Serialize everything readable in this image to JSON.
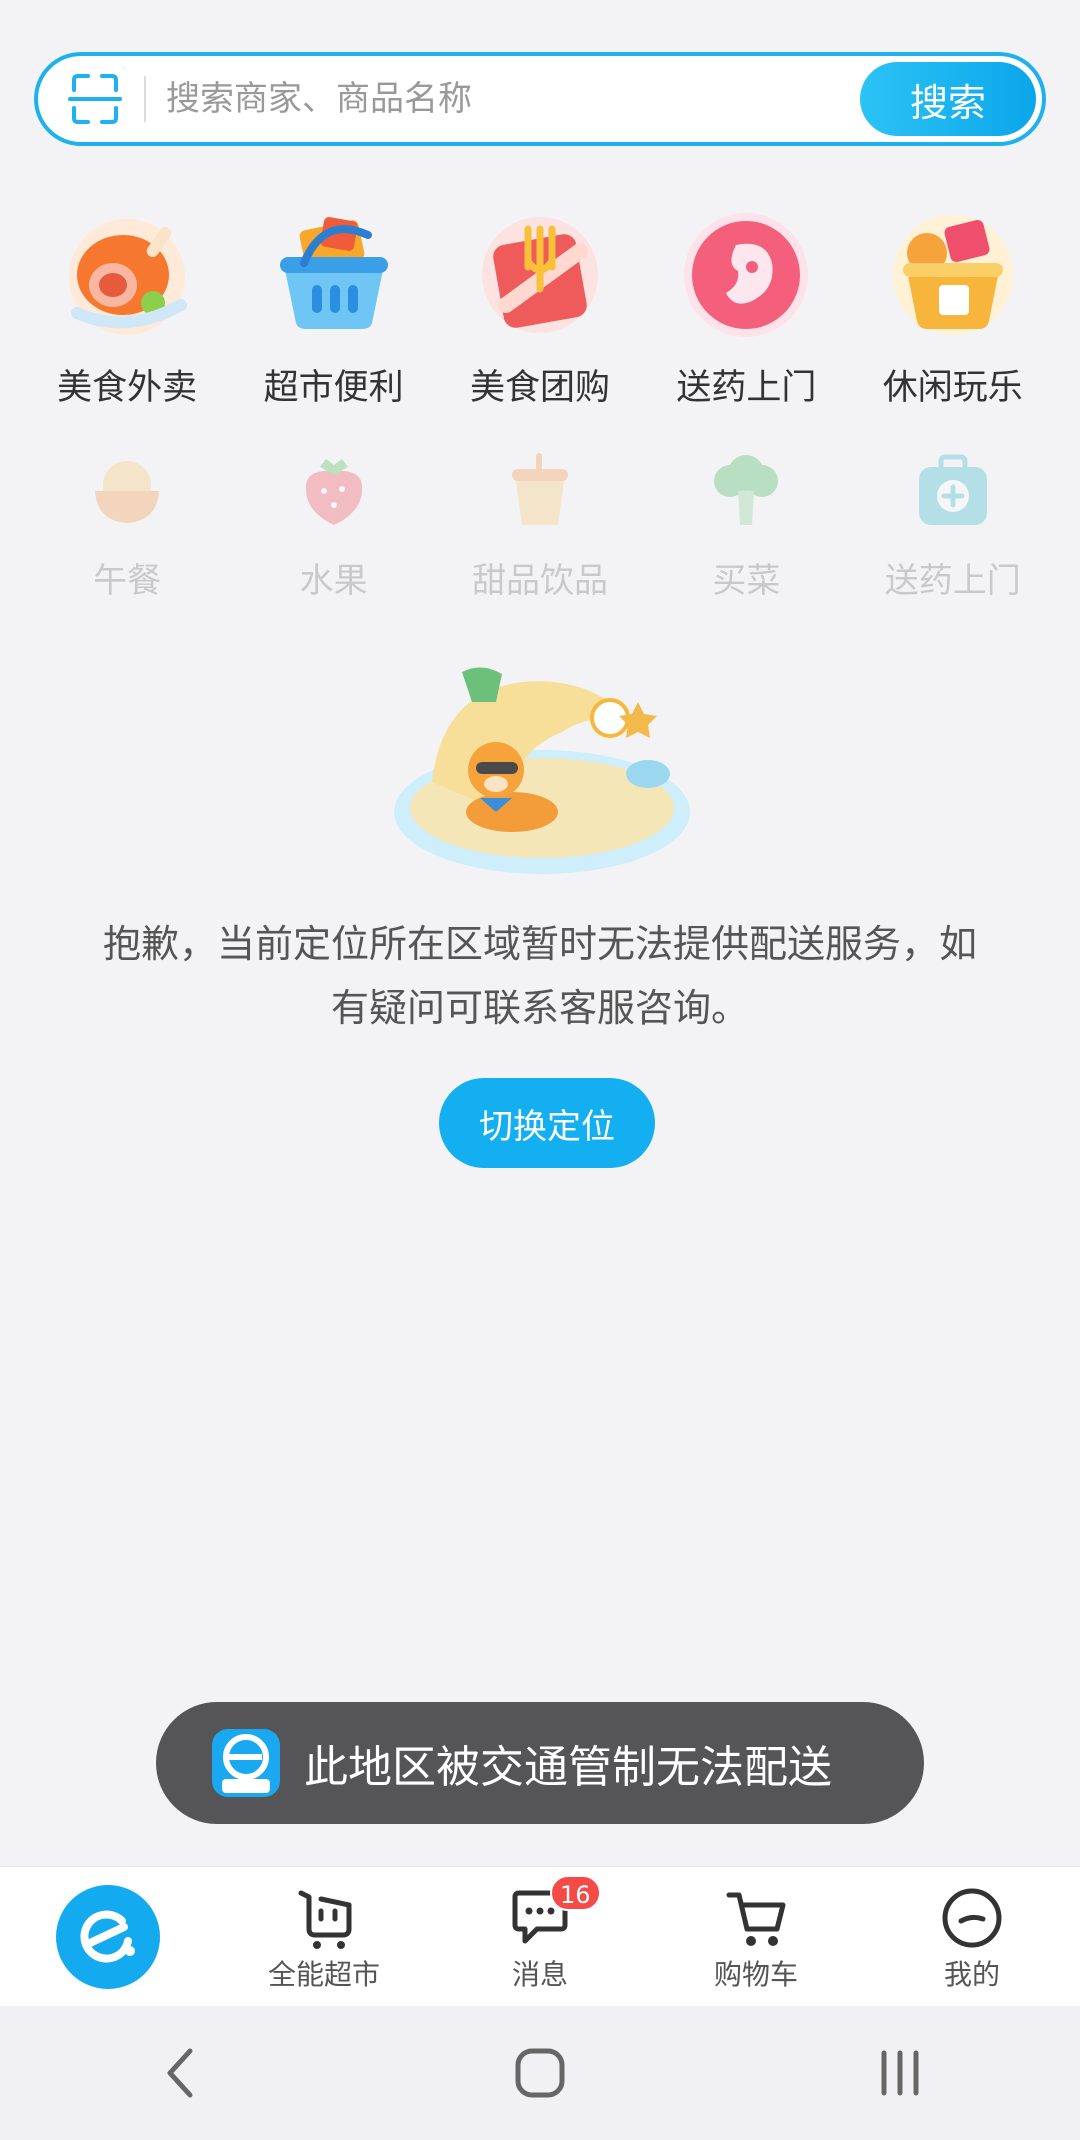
{
  "search": {
    "placeholder": "搜索商家、商品名称",
    "button_label": "搜索"
  },
  "categories_main": [
    {
      "label": "美食外卖",
      "icon": "roast-chicken-icon"
    },
    {
      "label": "超市便利",
      "icon": "shopping-basket-icon"
    },
    {
      "label": "美食团购",
      "icon": "fork-envelope-icon"
    },
    {
      "label": "送药上门",
      "icon": "pill-icon"
    },
    {
      "label": "休闲玩乐",
      "icon": "gift-basket-icon"
    }
  ],
  "categories_secondary": [
    {
      "label": "午餐",
      "icon": "rice-bowl-icon"
    },
    {
      "label": "水果",
      "icon": "strawberry-icon"
    },
    {
      "label": "甜品饮品",
      "icon": "drink-cup-icon"
    },
    {
      "label": "买菜",
      "icon": "broccoli-icon"
    },
    {
      "label": "送药上门",
      "icon": "medical-kit-icon"
    }
  ],
  "message": {
    "text": "抱歉，当前定位所在区域暂时无法提供配送服务，如有疑问可联系客服咨询。",
    "switch_button_label": "切换定位"
  },
  "toast": {
    "text": "此地区被交通管制无法配送"
  },
  "bottom_nav": {
    "items": [
      {
        "label": "全能超市",
        "icon": "cart-basket-icon"
      },
      {
        "label": "消息",
        "icon": "chat-bubble-icon",
        "badge": "16"
      },
      {
        "label": "购物车",
        "icon": "shopping-cart-icon"
      },
      {
        "label": "我的",
        "icon": "smiley-icon"
      }
    ]
  },
  "colors": {
    "brand_blue": "#14aff0",
    "badge_red": "#f54a45",
    "toast_bg": "#555558"
  }
}
